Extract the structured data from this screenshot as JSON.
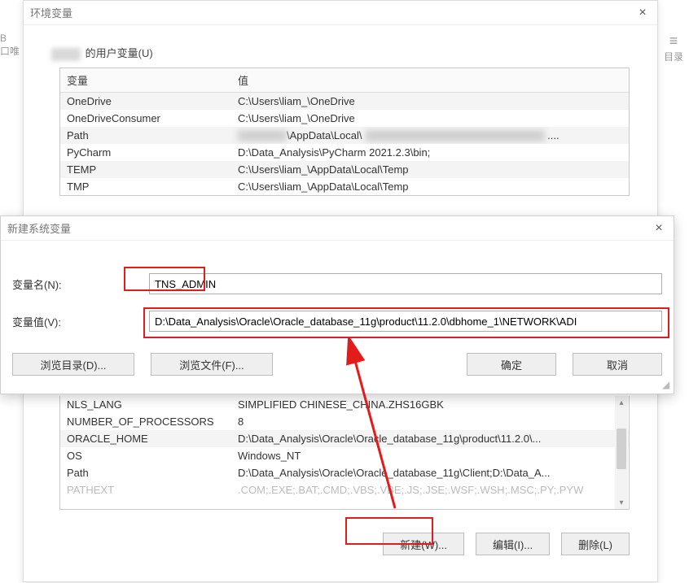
{
  "bg_left": {
    "line1": "B",
    "line2": "口唯"
  },
  "bg_right": {
    "icon": "≡",
    "label": "目录"
  },
  "env_window": {
    "title": "环境变量",
    "close_tooltip": "关闭",
    "section_user": "的用户变量(U)",
    "col_var": "变量",
    "col_val": "值",
    "user_vars": [
      {
        "name": "OneDrive",
        "value": "C:\\Users\\liam_\\OneDrive",
        "alt": true
      },
      {
        "name": "OneDriveConsumer",
        "value": "C:\\Users\\liam_\\OneDrive"
      },
      {
        "name": "Path",
        "value": "            \\AppData\\Local\\                                 ...",
        "alt": true,
        "blurred": true
      },
      {
        "name": "PyCharm",
        "value": "D:\\Data_Analysis\\PyCharm 2021.2.3\\bin;"
      },
      {
        "name": "TEMP",
        "value": "C:\\Users\\liam_\\AppData\\Local\\Temp",
        "alt": true
      },
      {
        "name": "TMP",
        "value": "C:\\Users\\liam_\\AppData\\Local\\Temp"
      }
    ],
    "sys_vars": [
      {
        "name": "NLS_LANG",
        "value": "SIMPLIFIED CHINESE_CHINA.ZHS16GBK"
      },
      {
        "name": "NUMBER_OF_PROCESSORS",
        "value": "8"
      },
      {
        "name": "ORACLE_HOME",
        "value": "D:\\Data_Analysis\\Oracle\\Oracle_database_11g\\product\\11.2.0\\...",
        "alt": true
      },
      {
        "name": "OS",
        "value": "Windows_NT"
      },
      {
        "name": "Path",
        "value": "D:\\Data_Analysis\\Oracle\\Oracle_database_11g\\Client;D:\\Data_A..."
      },
      {
        "name": "PATHEXT",
        "value": ".COM;.EXE;.BAT;.CMD;.VBS;.VBE;.JS;.JSE;.WSF;.WSH;.MSC;.PY;.PYW",
        "fade": true
      }
    ],
    "btn_new": "新建(W)...",
    "btn_edit": "编辑(I)...",
    "btn_del": "删除(L)"
  },
  "new_dialog": {
    "title": "新建系统变量",
    "label_name": "变量名(N):",
    "label_value": "变量值(V):",
    "value_name": "TNS_ADMIN",
    "value_value": "D:\\Data_Analysis\\Oracle\\Oracle_database_11g\\product\\11.2.0\\dbhome_1\\NETWORK\\ADI",
    "btn_browse_dir": "浏览目录(D)...",
    "btn_browse_file": "浏览文件(F)...",
    "btn_ok": "确定",
    "btn_cancel": "取消"
  }
}
